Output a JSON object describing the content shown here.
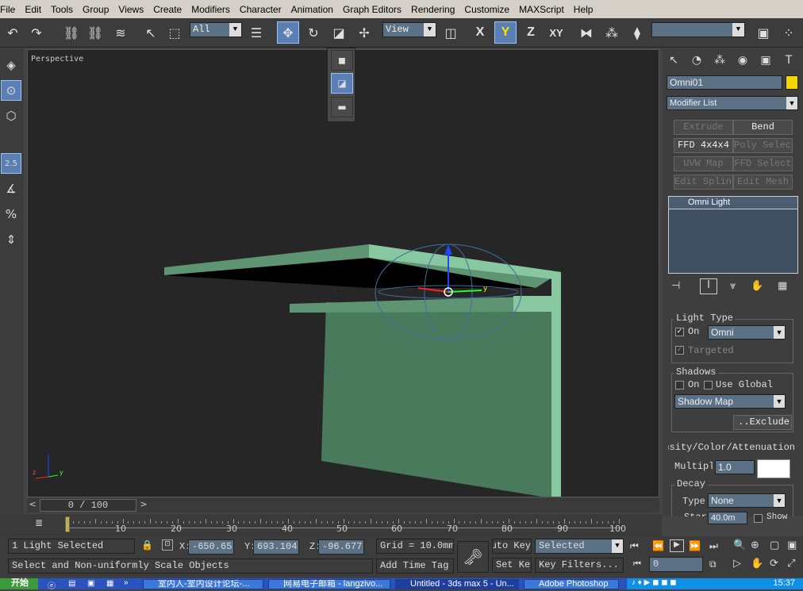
{
  "menu": [
    "File",
    "Edit",
    "Tools",
    "Group",
    "Views",
    "Create",
    "Modifiers",
    "Character",
    "Animation",
    "Graph Editors",
    "Rendering",
    "Customize",
    "MAXScript",
    "Help"
  ],
  "toolbar": {
    "selection_filter": "All",
    "ref_coord": "View",
    "named_selection": "",
    "axis_x": "X",
    "axis_y": "Y",
    "axis_z": "Z",
    "axis_xy": "XY"
  },
  "viewport": {
    "label": "Perspective",
    "axis_x": "x",
    "axis_y": "y",
    "axis_z": "z"
  },
  "left_tools": {
    "snap_label": "2.5"
  },
  "command_panel": {
    "object_name": "Omni01",
    "object_color": "#f5d800",
    "modifier_list": "Modifier List",
    "modifier_buttons": [
      {
        "label": "Extrude",
        "enabled": false
      },
      {
        "label": "Bend",
        "enabled": true
      },
      {
        "label": "FFD 4x4x4",
        "enabled": true
      },
      {
        "label": "Poly Select",
        "enabled": false
      },
      {
        "label": "UVW Map",
        "enabled": false
      },
      {
        "label": "FFD Select",
        "enabled": false
      },
      {
        "label": "Edit Spline",
        "enabled": false
      },
      {
        "label": "Edit Mesh",
        "enabled": false
      }
    ],
    "stack_item": "Omni Light",
    "light_type": {
      "title": "Light Type",
      "on_label": "On",
      "on_checked": true,
      "type_value": "Omni",
      "targeted_label": "Targeted"
    },
    "shadows": {
      "title": "Shadows",
      "on_label": "On",
      "use_global_label": "Use Global",
      "shadow_type": "Shadow Map",
      "exclude_label": "Exclude.."
    },
    "intensity": {
      "title": "Intensity/Color/Attenuation",
      "multiplier_label": "Multiplier",
      "multiplier_value": "1.0",
      "swatch_color": "#ffffff",
      "decay_title": "Decay",
      "type_label": "Type",
      "type_value": "None",
      "start_label": "Start",
      "start_value": "40.0m",
      "show_label": "Show"
    }
  },
  "timeline": {
    "position": "0 / 100",
    "ticks": [
      "10",
      "20",
      "30",
      "40",
      "50",
      "60",
      "70",
      "80",
      "90",
      "100"
    ]
  },
  "status": {
    "selection": "1 Light Selected",
    "prompt": "Select and Non-uniformly Scale Objects",
    "x_value": "-650.65",
    "y_value": "693.104",
    "z_value": "-96.677",
    "grid": "Grid = 10.0mm",
    "add_time_tag": "Add Time Tag",
    "auto_key": "Auto Key",
    "set_key": "Set Key",
    "key_mode": "Selected",
    "key_filters": "Key Filters...",
    "frame": "0"
  },
  "taskbar": {
    "start": "开始",
    "tasks": [
      {
        "label": "室内人-室内设计论坛-..."
      },
      {
        "label": "网易电子邮箱 - langzivo..."
      },
      {
        "label": "Untitled - 3ds max 5 - Un..."
      },
      {
        "label": "Adobe Photoshop"
      }
    ],
    "clock": "15:37"
  }
}
